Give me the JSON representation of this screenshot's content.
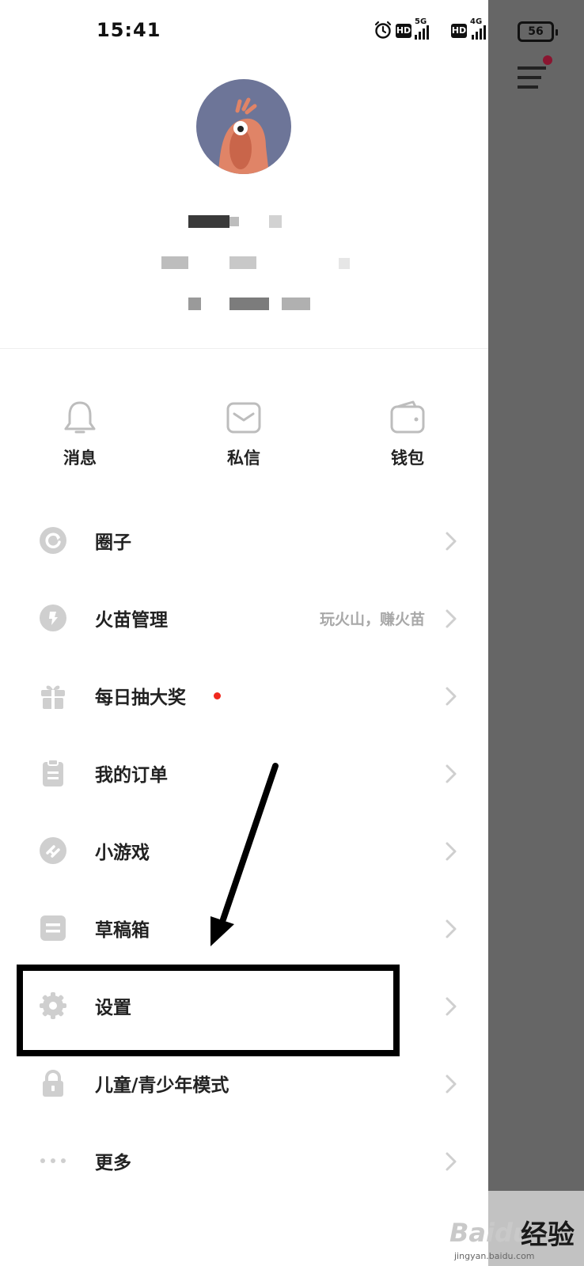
{
  "status_bar": {
    "time": "15:41",
    "hd1": "HD",
    "net1": "5G",
    "hd2": "HD",
    "net2": "4G",
    "battery": "56"
  },
  "quick_actions": [
    {
      "label": "消息",
      "icon": "bell-icon"
    },
    {
      "label": "私信",
      "icon": "envelope-icon"
    },
    {
      "label": "钱包",
      "icon": "wallet-icon"
    }
  ],
  "menu": [
    {
      "label": "圈子",
      "icon": "circle-refresh-icon",
      "hint": ""
    },
    {
      "label": "火苗管理",
      "icon": "flame-icon",
      "hint": "玩火山，赚火苗"
    },
    {
      "label": "每日抽大奖",
      "icon": "gift-icon",
      "hint": "",
      "badge": "red-dot"
    },
    {
      "label": "我的订单",
      "icon": "clipboard-icon",
      "hint": ""
    },
    {
      "label": "小游戏",
      "icon": "game-link-icon",
      "hint": ""
    },
    {
      "label": "草稿箱",
      "icon": "draft-box-icon",
      "hint": ""
    },
    {
      "label": "设置",
      "icon": "gear-icon",
      "hint": ""
    },
    {
      "label": "儿童/青少年模式",
      "icon": "lock-icon",
      "hint": ""
    },
    {
      "label": "更多",
      "icon": "more-dots-icon",
      "hint": ""
    }
  ],
  "watermark": {
    "logo": "Baidu",
    "brand": "经验",
    "url": "jingyan.baidu.com"
  },
  "colors": {
    "overlay": "#666666",
    "avatar_bg": "#6d7598",
    "accent_dot": "#f0281e",
    "menu_badge": "#8a1530",
    "icon_gray": "#cfcfcf"
  }
}
